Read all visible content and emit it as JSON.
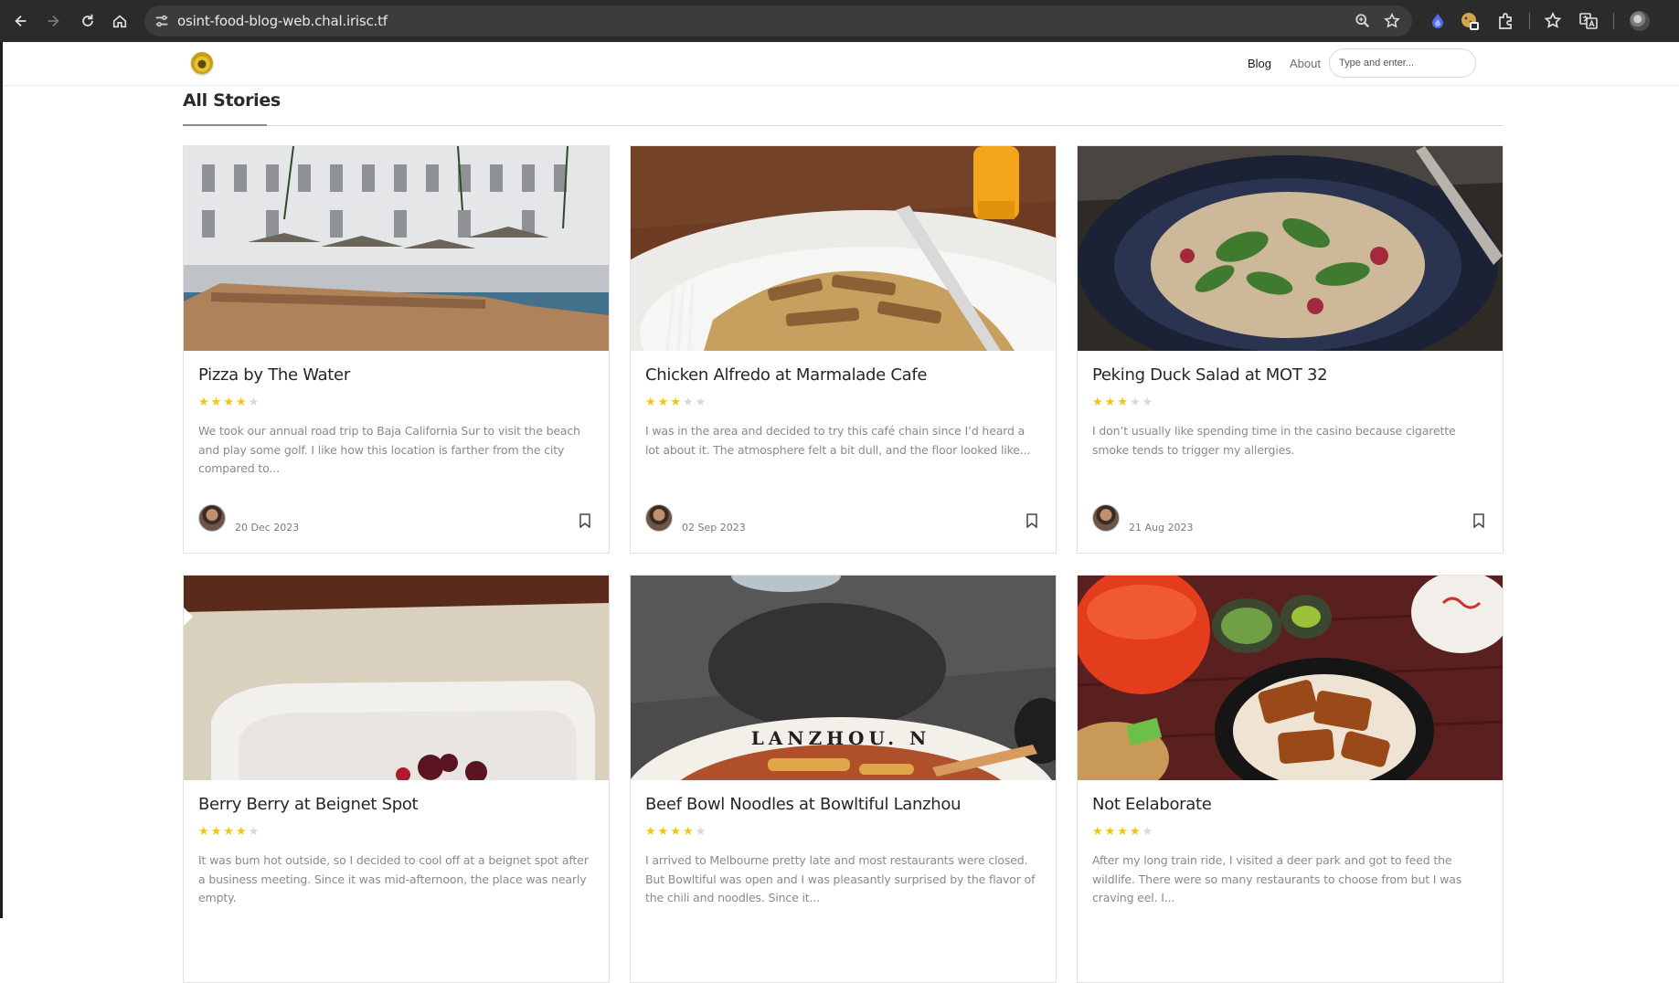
{
  "browser": {
    "url": "osint-food-blog-web.chal.irisc.tf"
  },
  "site": {
    "nav": {
      "blog_label": "Blog",
      "about_label": "About"
    },
    "search": {
      "placeholder": "Type and enter..."
    },
    "section_title": "All Stories"
  },
  "posts": [
    {
      "title": "Pizza by The Water",
      "rating": 4,
      "excerpt": "We took our annual road trip to Baja California Sur to visit the beach and play some golf. I like how this location is farther from the city compared to...",
      "date": "20 Dec 2023"
    },
    {
      "title": "Chicken Alfredo at Marmalade Cafe",
      "rating": 3,
      "excerpt": "I was in the area and decided to try this café chain since I’d heard a lot about it. The atmosphere felt a bit dull, and the floor looked like...",
      "date": "02 Sep 2023"
    },
    {
      "title": "Peking Duck Salad at MOT 32",
      "rating": 3,
      "excerpt": "I don’t usually like spending time in the casino because cigarette smoke tends to trigger my allergies.",
      "date": "21 Aug 2023"
    },
    {
      "title": "Berry Berry at Beignet Spot",
      "rating": 4,
      "excerpt": "It was bum hot outside, so I decided to cool off at a beignet spot after a business meeting. Since it was mid-afternoon, the place was nearly empty.",
      "date": ""
    },
    {
      "title": "Beef Bowl Noodles at Bowltiful Lanzhou",
      "rating": 4,
      "excerpt": "I arrived to Melbourne pretty late and most restaurants were closed. But Bowltiful was open and I was pleasantly surprised by the flavor of the chili and noodles. Since it...",
      "date": "",
      "image_text": "LANZHOU. N"
    },
    {
      "title": "Not Eelaborate",
      "rating": 4,
      "excerpt": "After my long train ride, I visited a deer park and got to feed the wildlife. There were so many restaurants to choose from but I was craving eel. I...",
      "date": ""
    }
  ]
}
